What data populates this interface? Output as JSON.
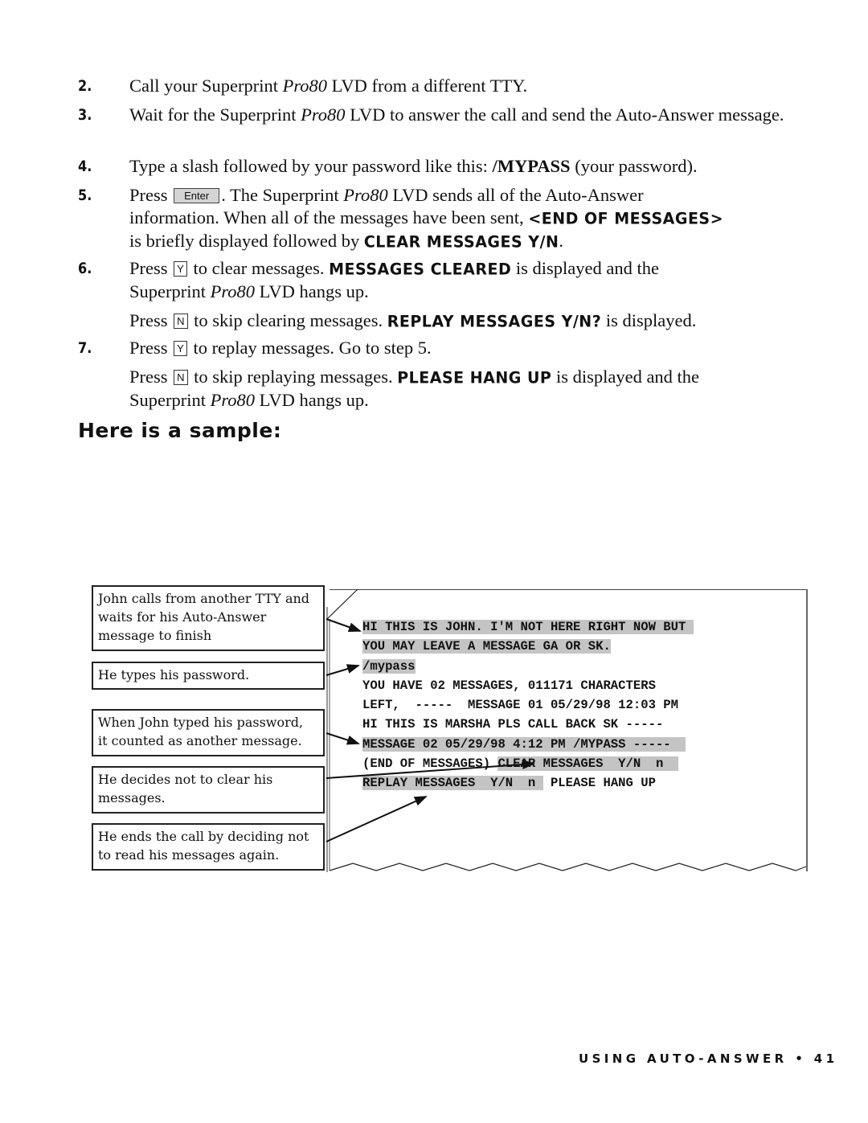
{
  "steps": [
    {
      "num": "2.",
      "parts": [
        "Call your Superprint ",
        "Pro80",
        " LVD from a different TTY."
      ]
    },
    {
      "num": "3.",
      "parts": [
        "Wait for the Superprint ",
        "Pro80",
        " LVD to answer the call and send the Auto-Answer message."
      ]
    },
    {
      "num": "4.",
      "parts": [
        "Type a slash followed by your password like this: ",
        "/MYPASS",
        " (your password)."
      ]
    },
    {
      "num": "5.",
      "press": "Press",
      "key": "Enter",
      "parts": [
        ". The Superprint ",
        "Pro80",
        " LVD sends all of the Auto-Answer",
        "information. When all of the messages have been sent, ",
        "<END OF MESSAGES>",
        "is briefly displayed followed by ",
        "CLEAR MESSAGES Y/N",
        "."
      ]
    },
    {
      "num": "6.",
      "press": "Press",
      "key": "Y",
      "parts": [
        "to clear messages. ",
        "MESSAGES CLEARED",
        " is displayed and the",
        "Superprint ",
        "Pro80",
        " LVD hangs up."
      ],
      "alt": {
        "press": "Press",
        "key": "N",
        "parts": [
          "to skip clearing messages. ",
          "REPLAY MESSAGES Y/N?",
          " is displayed."
        ]
      }
    },
    {
      "num": "7.",
      "press": "Press",
      "key": "Y",
      "parts": [
        "to replay messages. Go to step 5."
      ],
      "alt": {
        "press": "Press",
        "key": "N",
        "parts": [
          "to skip replaying messages. ",
          "PLEASE HANG UP",
          " is displayed and the",
          "Superprint ",
          "Pro80",
          " LVD hangs up."
        ]
      }
    }
  ],
  "sample_heading": "Here is a sample:",
  "callouts": [
    {
      "lines": [
        "John calls from another TTY and",
        "waits for his Auto-Answer",
        "message to finish"
      ]
    },
    {
      "lines": [
        "He types his password."
      ]
    },
    {
      "lines": [
        "When John typed his password,",
        "it counted as another message."
      ]
    },
    {
      "lines": [
        "He decides not to clear his",
        "messages."
      ]
    },
    {
      "lines": [
        "He ends the call by deciding not",
        "to read his messages again."
      ]
    }
  ],
  "tty_printout": {
    "lines": [
      {
        "text": "HI THIS IS JOHN. I'M NOT HERE RIGHT NOW BUT ",
        "highlight": true
      },
      {
        "text": "YOU MAY LEAVE A MESSAGE GA OR SK.",
        "highlight": true
      },
      {
        "text": "/mypass",
        "highlight": true
      },
      {
        "text": "YOU HAVE 02 MESSAGES, 011171 CHARACTERS",
        "highlight": false
      },
      {
        "text": "LEFT,  -----  MESSAGE 01 05/29/98 12:03 PM",
        "highlight": false
      },
      {
        "text": "HI THIS IS MARSHA PLS CALL BACK SK -----",
        "highlight": false
      },
      {
        "text": "MESSAGE 02 05/29/98 4:12 PM /MYPASS -----  ",
        "highlight": true
      },
      {
        "pre": "(END OF MESSAGES) ",
        "text": "CLEAR MESSAGES  Y/N  n  ",
        "highlight": true
      },
      {
        "text": "REPLAY MESSAGES  Y/N  n ",
        "post": " PLEASE HANG UP",
        "highlight": true
      }
    ]
  },
  "footer": "USING AUTO-ANSWER • 41"
}
